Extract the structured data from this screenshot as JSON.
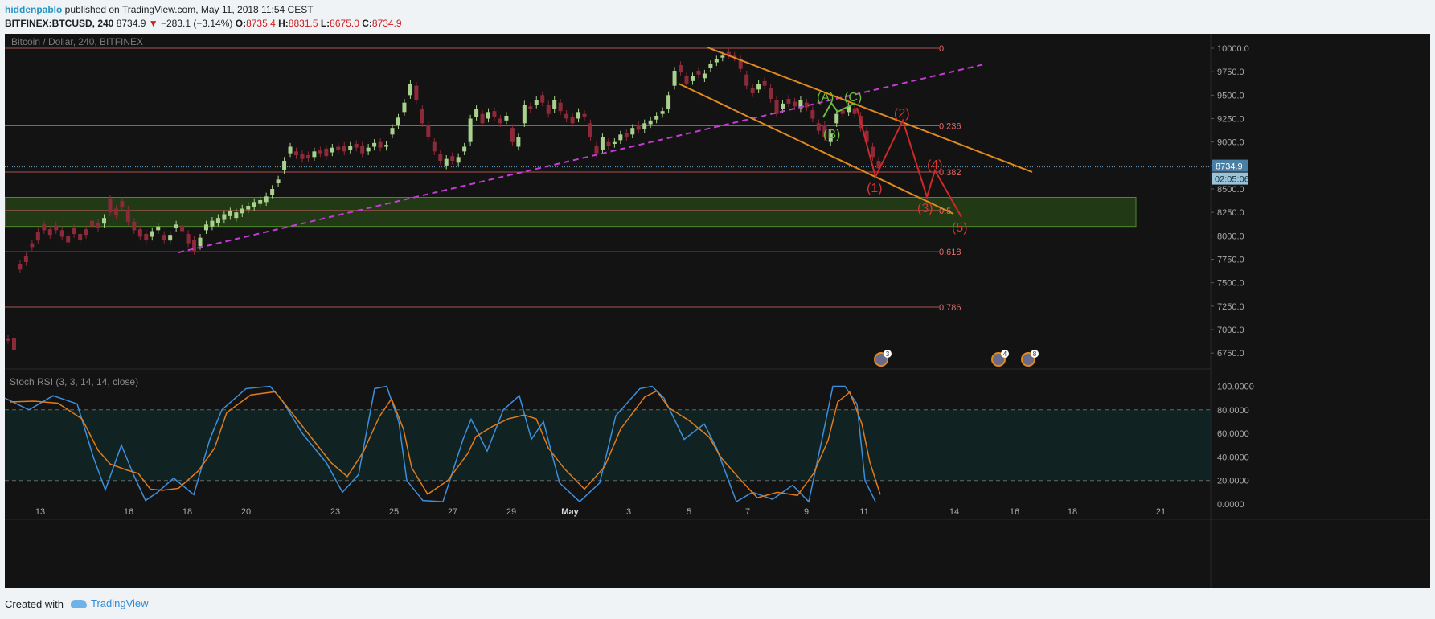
{
  "header": {
    "author": "hiddenpablo",
    "published_text": "published on TradingView.com, May 11, 2018 11:54 CEST",
    "symbol": "BITFINEX:BTCUSD, 240",
    "last_price": "8734.9",
    "change": "−283.1 (−3.14%)",
    "o_label": "O:",
    "o_value": "8735.4",
    "h_label": "H:",
    "h_value": "8831.5",
    "l_label": "L:",
    "l_value": "8675.0",
    "c_label": "C:",
    "c_value": "8734.9"
  },
  "chart": {
    "pane_title": "Bitcoin / Dollar, 240, BITFINEX",
    "price_axis": [
      "10000.0",
      "9750.0",
      "9500.0",
      "9250.0",
      "9000.0",
      "8750.0",
      "8500.0",
      "8250.0",
      "8000.0",
      "7750.0",
      "7500.0",
      "7250.0",
      "7000.0",
      "6750.0"
    ],
    "price_axis_values": [
      10000,
      9750,
      9500,
      9250,
      9000,
      8750,
      8500,
      8250,
      8000,
      7750,
      7500,
      7250,
      7000,
      6750
    ],
    "price_badge": "8734.9",
    "time_badge": "02:05:06",
    "fib_levels": [
      {
        "label": "0",
        "price": 10000
      },
      {
        "label": "0.236",
        "price": 9173
      },
      {
        "label": "0.382",
        "price": 8680
      },
      {
        "label": "0.5",
        "price": 8270
      },
      {
        "label": "0.618",
        "price": 7830
      },
      {
        "label": "0.786",
        "price": 7240
      }
    ],
    "zone": {
      "from": 8100,
      "to": 8410
    },
    "wave_labels_green": [
      "(A)",
      "(B)",
      "(C)"
    ],
    "wave_labels_red": [
      "(1)",
      "(2)",
      "(3)",
      "(4)",
      "(5)"
    ],
    "event_badges": [
      "3",
      "4",
      "8"
    ],
    "time_axis": [
      "13",
      "16",
      "18",
      "20",
      "23",
      "25",
      "27",
      "29",
      "May",
      "3",
      "5",
      "7",
      "9",
      "11",
      "14",
      "16",
      "18",
      "21"
    ],
    "colors": {
      "up": "#a9d18e",
      "down": "#8c2a3a",
      "fib": "#e26a6a",
      "channel": "#e08a1e",
      "trend": "#c63bd6",
      "zone": "#2e5a18",
      "green_label": "#6abf3a",
      "red_label": "#e03030",
      "k_line": "#3d8fdb",
      "d_line": "#e07b1c"
    }
  },
  "indicator": {
    "title": "Stoch RSI (3, 3, 14, 14, close)",
    "axis": [
      "100.0000",
      "80.0000",
      "60.0000",
      "40.0000",
      "20.0000",
      "0.0000"
    ],
    "axis_values": [
      100,
      80,
      60,
      40,
      20,
      0
    ]
  },
  "footer": {
    "created_with": "Created with",
    "brand": "TradingView"
  }
}
